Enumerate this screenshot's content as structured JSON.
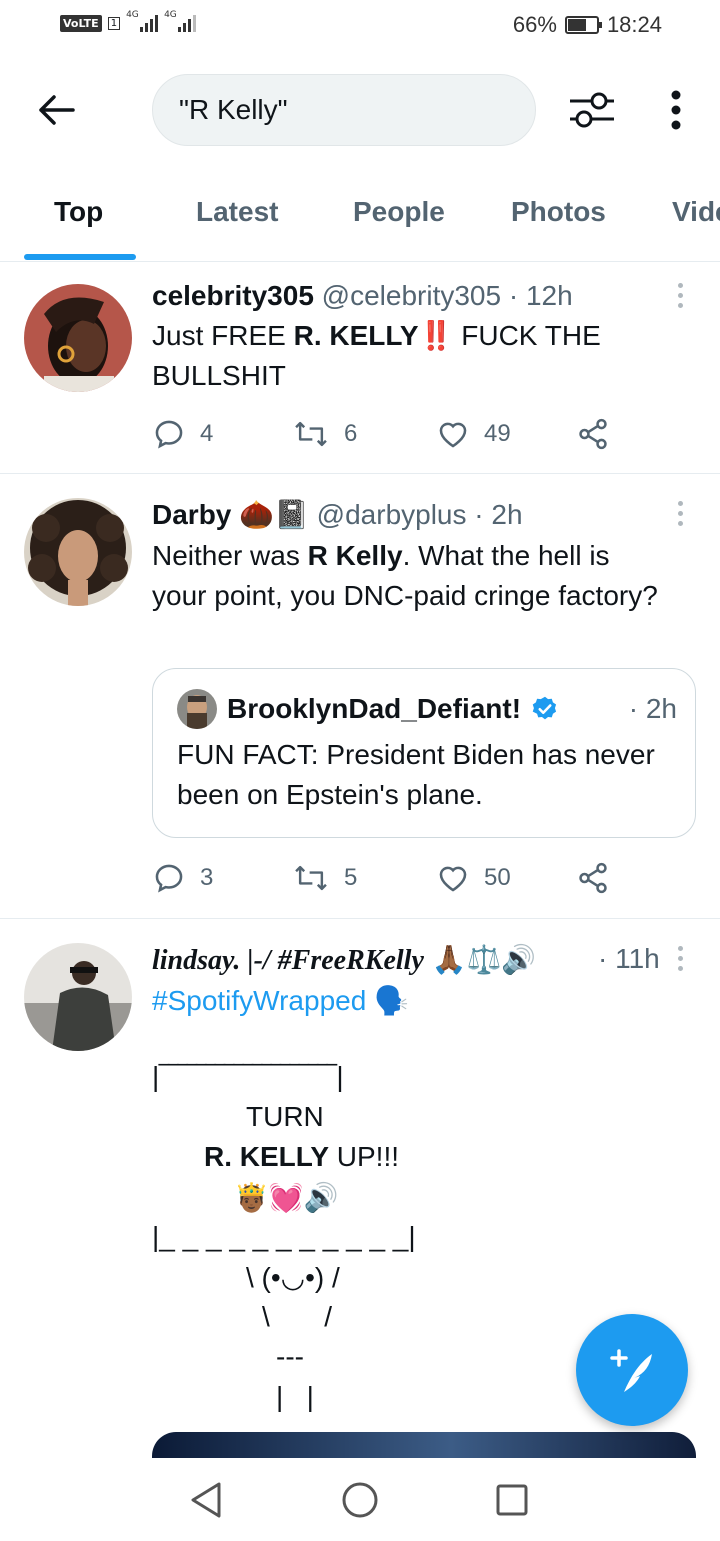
{
  "status_bar": {
    "carrier_badge": "VoLTE",
    "sim_slot": "1",
    "net1": "4G",
    "net2": "4G",
    "battery_percent": "66%",
    "battery_level": 0.66,
    "time": "18:24"
  },
  "search": {
    "query": "\"R Kelly\""
  },
  "tabs": [
    {
      "label": "Top",
      "active": true
    },
    {
      "label": "Latest"
    },
    {
      "label": "People"
    },
    {
      "label": "Photos"
    },
    {
      "label": "Videos"
    }
  ],
  "tweets": [
    {
      "name": "celebrity305",
      "handle": "@celebrity305",
      "time": "· 12h",
      "body_pre": "Just FREE ",
      "body_bold": "R. KELLY",
      "body_emoji": "‼️",
      "body_post": " FUCK THE BULLSHIT",
      "replies": "4",
      "retweets": "6",
      "likes": "49"
    },
    {
      "name": "Darby",
      "name_emoji": "🌰📓",
      "handle": "@darbyplus",
      "time": "· 2h",
      "body_pre": "Neither was ",
      "body_bold": "R Kelly",
      "body_post": ". What the hell is your point, you DNC-paid cringe factory?",
      "quote": {
        "name": "BrooklynDad_Defiant!",
        "time": "· 2h",
        "body": "FUN FACT: President Biden has never been on Epstein's plane."
      },
      "replies": "3",
      "retweets": "5",
      "likes": "50"
    },
    {
      "name": "lindsay. |-/ #FreeRKelly",
      "name_emoji": "🙏🏾⚖️🔊",
      "time": "· 11h",
      "hashtag": "#SpotifyWrapped",
      "hashtag_emoji": "🗣️",
      "ascii": {
        "top_border": "|‾‾‾‾‾‾‾‾‾‾‾‾‾‾‾‾‾‾‾|",
        "line1": "TURN",
        "line2_bold": "R. KELLY",
        "line2_rest": " UP!!!",
        "line3": "🤴🏾💓🔊",
        "bottom_border": "|_ _ _ _ _ _ _ _ _ _ _|",
        "figure1": "\\ (•◡•) /",
        "figure2": "\\       /",
        "figure3": "---",
        "figure4": "|   |"
      }
    }
  ],
  "colors": {
    "accent": "#1d9bf0",
    "text": "#0f1419",
    "secondary": "#536471",
    "divider": "#e6ecf0"
  }
}
